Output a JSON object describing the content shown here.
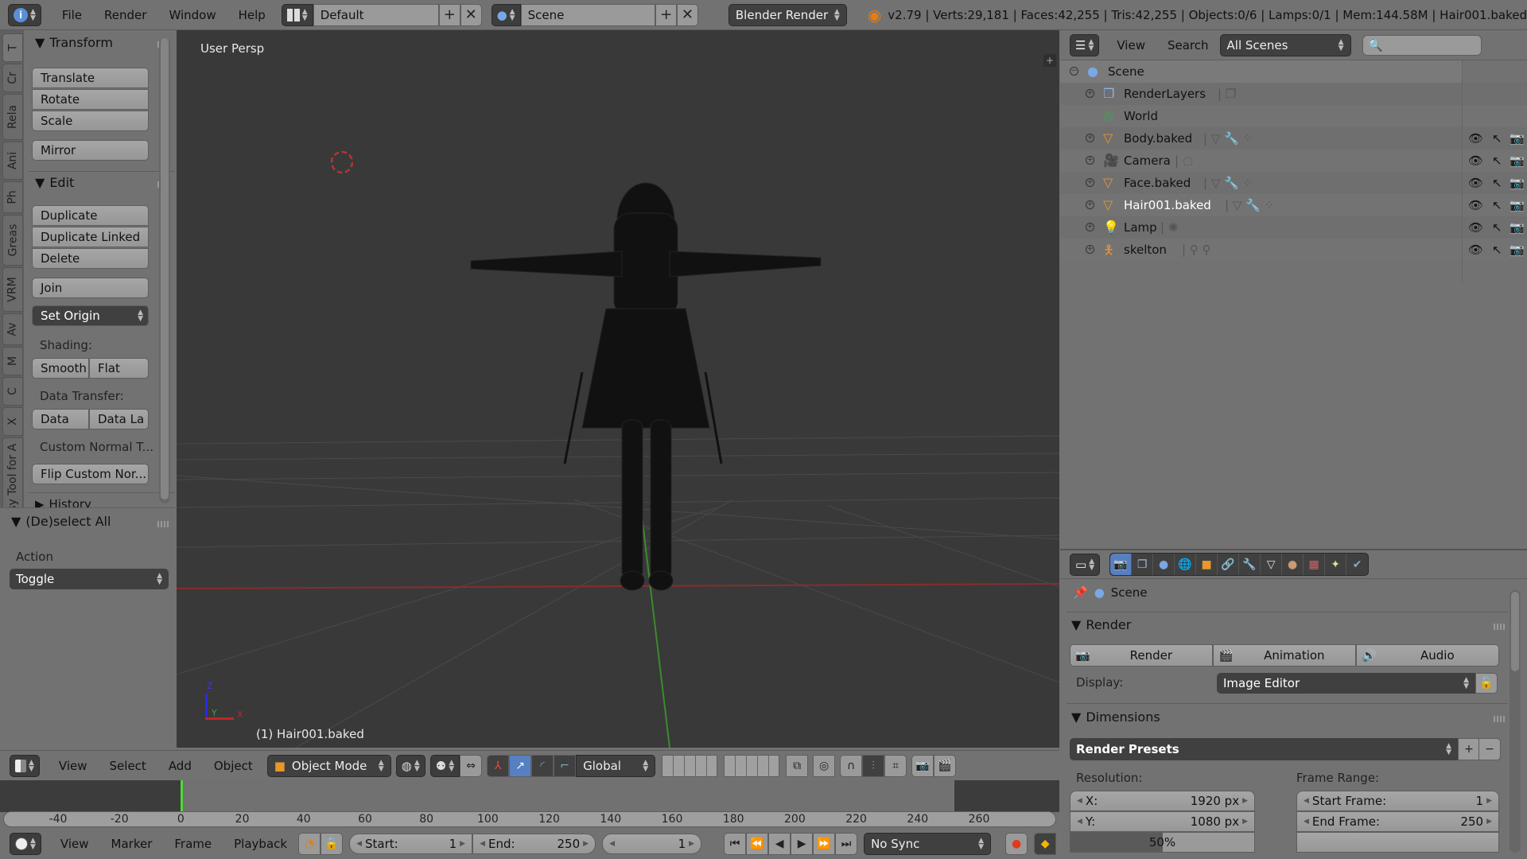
{
  "topbar": {
    "menus": [
      "File",
      "Render",
      "Window",
      "Help"
    ],
    "screen_layout": "Default",
    "scene": "Scene",
    "render_engine": "Blender Render",
    "stats": "v2.79 | Verts:29,181 | Faces:42,255 | Tris:42,255 | Objects:0/6 | Lamps:0/1 | Mem:144.58M | Hair001.baked"
  },
  "toolshelf": {
    "tabs": [
      "T",
      "Cr",
      "Rela",
      "Ani",
      "Ph",
      "Greas",
      "VRM",
      "Av",
      "M",
      "C",
      "X",
      "Easy Tool for A"
    ],
    "transform": {
      "title": "Transform",
      "buttons": [
        "Translate",
        "Rotate",
        "Scale"
      ],
      "mirror": "Mirror"
    },
    "edit": {
      "title": "Edit",
      "buttons": [
        "Duplicate",
        "Duplicate Linked",
        "Delete"
      ],
      "join": "Join",
      "set_origin": "Set Origin",
      "shading_label": "Shading:",
      "shading_buttons": [
        "Smooth",
        "Flat"
      ],
      "data_transfer_label": "Data Transfer:",
      "data_transfer_buttons": [
        "Data",
        "Data La"
      ],
      "custom_normal_label": "Custom Normal T...",
      "flip_custom": "Flip Custom Nor..."
    },
    "history": "History"
  },
  "operator_panel": {
    "title": "(De)select All",
    "action_label": "Action",
    "action_value": "Toggle"
  },
  "viewport": {
    "view_label": "User Persp",
    "active_object": "(1) Hair001.baked",
    "axis_labels": {
      "x": "X",
      "y": "Y",
      "z": "Z"
    }
  },
  "viewport_header": {
    "menus": [
      "View",
      "Select",
      "Add",
      "Object"
    ],
    "mode": "Object Mode",
    "orientation": "Global"
  },
  "timeline": {
    "ticks": [
      "-40",
      "-20",
      "0",
      "20",
      "40",
      "60",
      "80",
      "100",
      "120",
      "140",
      "160",
      "180",
      "200",
      "220",
      "240",
      "260"
    ],
    "current_frame_marker": 0,
    "menus": [
      "View",
      "Marker",
      "Frame",
      "Playback"
    ],
    "start_label": "Start:",
    "start_value": "1",
    "end_label": "End:",
    "end_value": "250",
    "current_frame": "1",
    "sync": "No Sync"
  },
  "outliner": {
    "menus": [
      "View",
      "Search"
    ],
    "display_mode": "All Scenes",
    "search_placeholder": "",
    "rows": [
      {
        "name": "Scene",
        "icon": "scene-icon",
        "level": 0
      },
      {
        "name": "RenderLayers",
        "icon": "render-layers-icon",
        "level": 1
      },
      {
        "name": "World",
        "icon": "world-icon",
        "level": 1
      },
      {
        "name": "Body.baked",
        "icon": "mesh-icon",
        "level": 1
      },
      {
        "name": "Camera",
        "icon": "camera-icon",
        "level": 1
      },
      {
        "name": "Face.baked",
        "icon": "mesh-icon",
        "level": 1
      },
      {
        "name": "Hair001.baked",
        "icon": "mesh-icon",
        "level": 1
      },
      {
        "name": "Lamp",
        "icon": "lamp-icon",
        "level": 1
      },
      {
        "name": "skelton",
        "icon": "armature-icon",
        "level": 1
      }
    ]
  },
  "properties": {
    "context": "Scene",
    "render_panel": {
      "title": "Render",
      "buttons": [
        "Render",
        "Animation",
        "Audio"
      ],
      "display_label": "Display:",
      "display_value": "Image Editor"
    },
    "dimensions_panel": {
      "title": "Dimensions",
      "presets": "Render Presets",
      "resolution_label": "Resolution:",
      "res_x_label": "X:",
      "res_x": "1920 px",
      "res_y_label": "Y:",
      "res_y": "1080 px",
      "res_percent": "50%",
      "frame_range_label": "Frame Range:",
      "start_frame_label": "Start Frame:",
      "start_frame": "1",
      "end_frame_label": "End Frame:",
      "end_frame": "250"
    }
  }
}
